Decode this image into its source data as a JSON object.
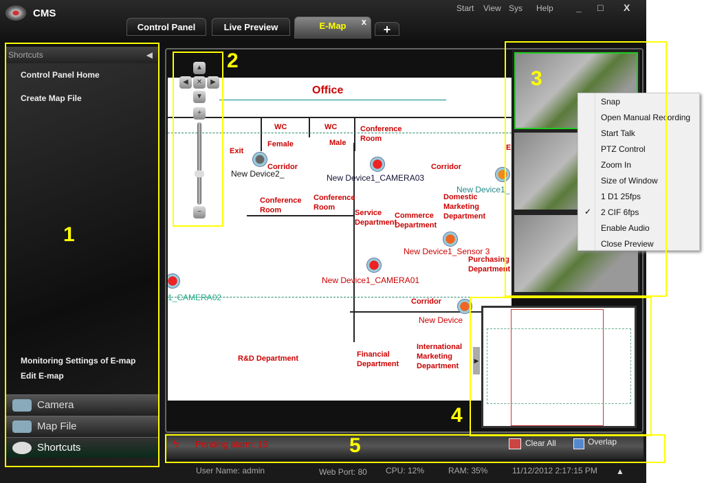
{
  "app": {
    "title": "CMS",
    "menu": [
      "Start",
      "View",
      "Sys",
      "Help"
    ],
    "window_buttons": [
      "_",
      "□",
      "X"
    ]
  },
  "tabs": [
    {
      "label": "Control Panel"
    },
    {
      "label": "Live Preview"
    },
    {
      "label": "E-Map",
      "active": true,
      "close": "x"
    },
    {
      "label": "+"
    }
  ],
  "sidebar": {
    "header": "Shortcuts",
    "items": [
      "Control Panel Home",
      "Create Map File"
    ],
    "bottom_items": [
      "Monitoring Settings of E-map",
      "Edit E-map"
    ],
    "accordion": [
      {
        "label": "Camera"
      },
      {
        "label": "Map File"
      },
      {
        "label": "Shortcuts",
        "active": true
      }
    ]
  },
  "map": {
    "title": "Office",
    "rooms": [
      "WC",
      "Female",
      "WC",
      "Male",
      "Conference Room",
      "Exit",
      "Corridor",
      "Conference Room",
      "Conference Room",
      "Service Department",
      "Commerce Department",
      "Domestic Marketing Department",
      "Purchasing Department",
      "Corridor",
      "Corridor",
      "R&D Department",
      "Financial Department",
      "International Marketing Department",
      "Exit"
    ],
    "devices": [
      "New Device2_",
      "New Device1_CAMERA03",
      "New Device1_",
      "New Device1_Sensor 3",
      "New Device1_CAMERA01",
      "1_CAMERA02",
      "New Device"
    ]
  },
  "context_menu": {
    "items": [
      {
        "label": "Snap"
      },
      {
        "label": "Open Manual Recording"
      },
      {
        "label": "Start Talk"
      },
      {
        "label": "PTZ Control"
      },
      {
        "label": "Zoom In"
      },
      {
        "label": "Size of Window"
      },
      {
        "label": "1 D1 25fps"
      },
      {
        "label": "2 CIF 6fps",
        "checked": true
      },
      {
        "label": "Enable Audio"
      },
      {
        "label": "Close Preview"
      }
    ],
    "check": "✓"
  },
  "alarm": {
    "text": "Pending alarm: 15",
    "clear_all": "Clear All",
    "overlap": "Overlap"
  },
  "status": {
    "user": "User Name: admin",
    "web_port": "Web Port: 80",
    "cpu": "CPU: 12%",
    "ram": "RAM: 35%",
    "datetime": "11/12/2012 2:17:15 PM",
    "arrow": "▲"
  },
  "annotations": [
    "1",
    "2",
    "3",
    "4",
    "5"
  ],
  "colors": {
    "annotation": "#ffff00",
    "alarm": "#dd0000",
    "room_label": "#cc0000",
    "selected_video": "#22cc22"
  }
}
